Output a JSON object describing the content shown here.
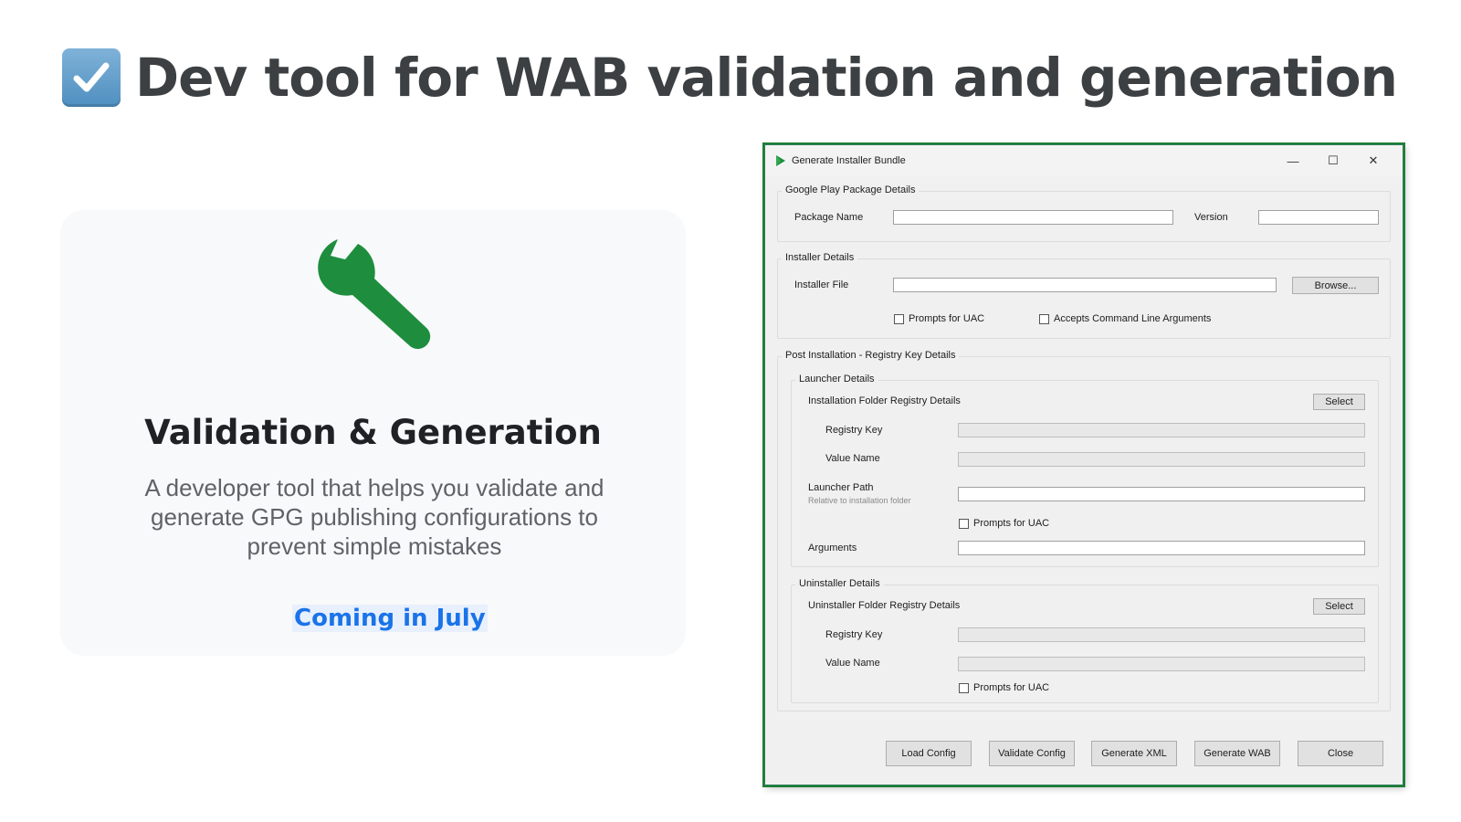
{
  "slide": {
    "title": "Dev tool for WAB validation and generation",
    "title_icon": "check-box-icon"
  },
  "card": {
    "icon": "wrench-icon",
    "title": "Validation & Generation",
    "description": "A developer tool that helps you validate and generate GPG publishing configurations to prevent simple mistakes",
    "link": "Coming in July",
    "colors": {
      "wrench": "#1e8e3e",
      "link": "#1a73e8",
      "link_bg": "#e8f0fe"
    }
  },
  "dialog": {
    "title": "Generate Installer Bundle",
    "window_buttons": {
      "minimize": "—",
      "maximize": "☐",
      "close": "✕"
    },
    "package_group": {
      "legend": "Google Play Package Details",
      "package_name_label": "Package Name",
      "package_name_value": "",
      "version_label": "Version",
      "version_value": ""
    },
    "installer_group": {
      "legend": "Installer Details",
      "installer_file_label": "Installer File",
      "installer_file_value": "",
      "browse_button": "Browse...",
      "prompts_uac": "Prompts for UAC",
      "accepts_args": "Accepts Command Line Arguments"
    },
    "post_install_group": {
      "legend": "Post Installation - Registry Key Details",
      "launcher": {
        "legend": "Launcher Details",
        "folder_registry_label": "Installation Folder Registry Details",
        "select_button": "Select",
        "registry_key_label": "Registry Key",
        "value_name_label": "Value Name",
        "launcher_path_label": "Launcher Path",
        "launcher_path_hint": "Relative to installation folder",
        "prompts_uac": "Prompts for UAC",
        "arguments_label": "Arguments"
      },
      "uninstaller": {
        "legend": "Uninstaller Details",
        "folder_registry_label": "Uninstaller Folder Registry Details",
        "select_button": "Select",
        "registry_key_label": "Registry Key",
        "value_name_label": "Value Name",
        "prompts_uac": "Prompts for UAC"
      }
    },
    "footer": {
      "load_config": "Load Config",
      "validate_config": "Validate Config",
      "generate_xml": "Generate XML",
      "generate_wab": "Generate WAB",
      "close": "Close"
    }
  }
}
